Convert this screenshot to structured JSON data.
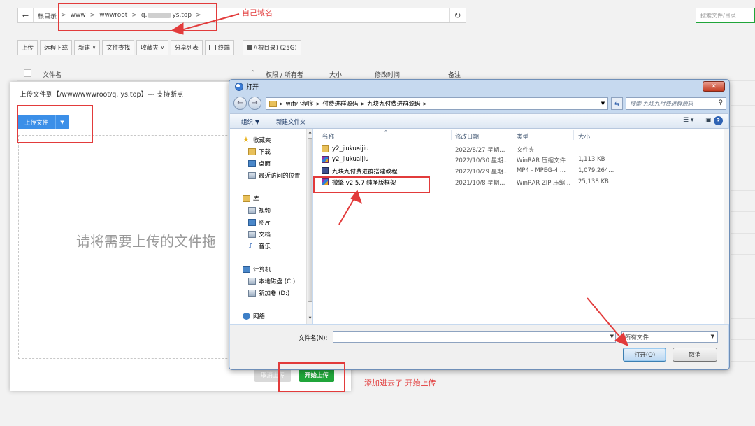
{
  "file_manager": {
    "path": {
      "root_label": "根目录",
      "segments": [
        "www",
        "wwwroot",
        "q.",
        "ys.top"
      ]
    },
    "search_placeholder": "搜索文件/目录",
    "toolbar": {
      "upload": "上传",
      "remote_download": "远程下载",
      "new": "新建",
      "file_search": "文件查找",
      "favorites": "收藏夹",
      "share_list": "分享列表",
      "terminal": "终端",
      "disk": "/(根目录) (25G)"
    },
    "columns": {
      "name": "文件名",
      "permission": "权限 / 所有者",
      "size": "大小",
      "modified": "修改时间",
      "note": "备注"
    }
  },
  "upload_dialog": {
    "title": "上传文件到【/www/wwwroot/q.     ys.top】--- 支持断点",
    "upload_file_button": "上传文件",
    "drop_hint": "请将需要上传的文件拖",
    "cancel_upload": "取消上传",
    "start_upload": "开始上传"
  },
  "open_dialog": {
    "title": "打开",
    "address": [
      "wifi小程序",
      "付费进群源码",
      "九块九付费进群源码"
    ],
    "search_placeholder": "搜索 九块九付费进群源码",
    "commands": {
      "organize": "组织 ▼",
      "new_folder": "新建文件夹"
    },
    "nav": {
      "favorites": "收藏夹",
      "downloads": "下载",
      "desktop": "桌面",
      "recent": "最近访问的位置",
      "libraries": "库",
      "videos": "视频",
      "pictures": "图片",
      "documents": "文档",
      "music": "音乐",
      "computer": "计算机",
      "disk_c": "本地磁盘 (C:)",
      "disk_d": "新加卷 (D:)",
      "network": "网络"
    },
    "columns": {
      "name": "名称",
      "date": "修改日期",
      "type": "类型",
      "size": "大小"
    },
    "files": [
      {
        "name": "y2_jiukuaijiu",
        "date": "2022/8/27 星期...",
        "type": "文件夹",
        "size": "",
        "icon": "folder-icon"
      },
      {
        "name": "y2_jiukuaijiu",
        "date": "2022/10/30 星期...",
        "type": "WinRAR 压缩文件",
        "size": "1,113 KB",
        "icon": "archive-icon"
      },
      {
        "name": "九块九付费进群搭建教程",
        "date": "2022/10/29 星期...",
        "type": "MP4 - MPEG-4 ...",
        "size": "1,079,264...",
        "icon": "video-file-icon"
      },
      {
        "name": "微擎 v2.5.7 纯净版框架",
        "date": "2021/10/8 星期...",
        "type": "WinRAR ZIP 压缩...",
        "size": "25,138 KB",
        "icon": "archive-icon"
      }
    ],
    "filename_label": "文件名(N):",
    "filename_value": "",
    "filetype": "所有文件",
    "open_button": "打开(O)",
    "cancel_button": "取消"
  },
  "annotations": {
    "own_domain": "自己域名",
    "added_start_upload": "添加进去了 开始上传"
  },
  "colors": {
    "annotation": "#e23b3b",
    "primary_blue": "#3b8fe8",
    "success_green": "#20a53a"
  }
}
